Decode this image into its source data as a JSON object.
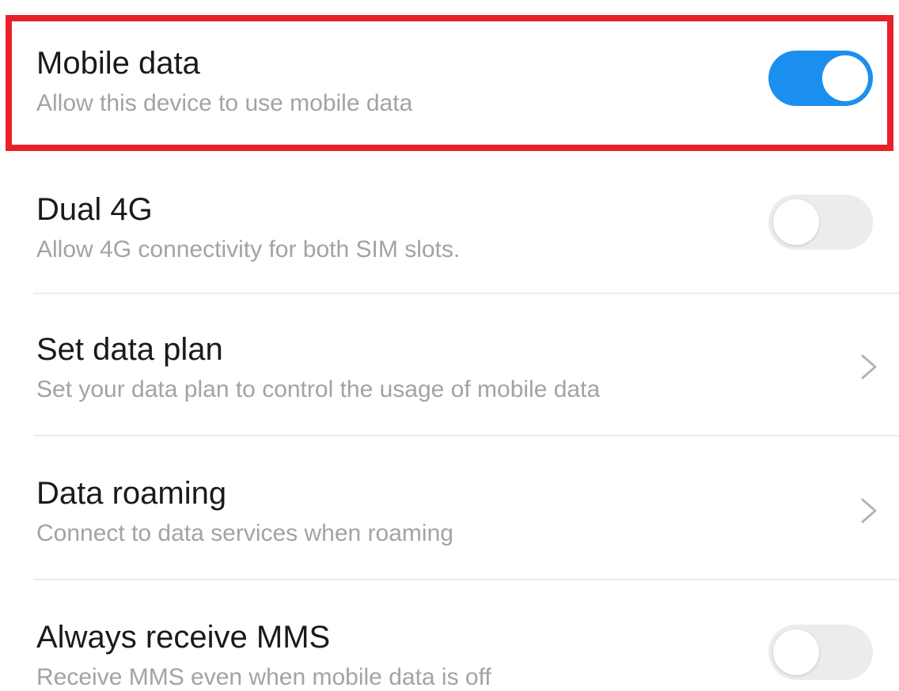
{
  "colors": {
    "toggle_on": "#1b8ff0",
    "toggle_off": "#ececec",
    "highlight": "#e8202a"
  },
  "items": [
    {
      "title": "Mobile data",
      "subtitle": "Allow this device to use mobile data",
      "control": "toggle",
      "checked": true
    },
    {
      "title": "Dual 4G",
      "subtitle": "Allow 4G connectivity for both SIM slots.",
      "control": "toggle",
      "checked": false
    },
    {
      "title": "Set data plan",
      "subtitle": "Set your data plan to control the usage of mobile data",
      "control": "chevron-right-icon"
    },
    {
      "title": "Data roaming",
      "subtitle": "Connect to data services when roaming",
      "control": "chevron-right-icon"
    },
    {
      "title": "Always receive MMS",
      "subtitle": "Receive MMS even when mobile data is off",
      "control": "toggle",
      "checked": false
    }
  ]
}
